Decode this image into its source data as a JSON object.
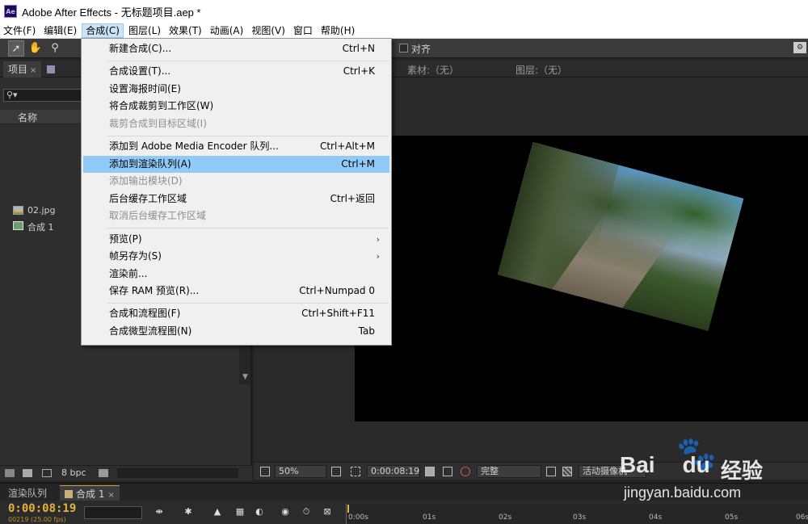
{
  "window": {
    "title": "Adobe After Effects - 无标题项目.aep *",
    "logo_text": "Ae"
  },
  "menubar": [
    {
      "label": "文件(F)"
    },
    {
      "label": "编辑(E)"
    },
    {
      "label": "合成(C)",
      "active": true
    },
    {
      "label": "图层(L)"
    },
    {
      "label": "效果(T)"
    },
    {
      "label": "动画(A)"
    },
    {
      "label": "视图(V)"
    },
    {
      "label": "窗口"
    },
    {
      "label": "帮助(H)"
    }
  ],
  "toolbar": {
    "align_label": "对齐"
  },
  "project_panel": {
    "tab_label": "项目",
    "close_glyph": "×",
    "column_name": "名称",
    "items": [
      {
        "label": "02.jpg",
        "type": "image"
      },
      {
        "label": "合成 1",
        "type": "composition"
      }
    ],
    "bit_depth": "8 bpc"
  },
  "composition_header": {
    "footage_label": "素材:（无）",
    "layer_label": "图层:（无）"
  },
  "composition_menu": {
    "groups": [
      [
        {
          "label": "新建合成(C)...",
          "shortcut": "Ctrl+N"
        }
      ],
      [
        {
          "label": "合成设置(T)...",
          "shortcut": "Ctrl+K"
        },
        {
          "label": "设置海报时间(E)",
          "shortcut": ""
        },
        {
          "label": "将合成裁剪到工作区(W)",
          "shortcut": ""
        },
        {
          "label": "裁剪合成到目标区域(I)",
          "shortcut": "",
          "disabled": true
        }
      ],
      [
        {
          "label": "添加到 Adobe Media Encoder 队列...",
          "shortcut": "Ctrl+Alt+M"
        },
        {
          "label": "添加到渲染队列(A)",
          "shortcut": "Ctrl+M",
          "highlighted": true
        },
        {
          "label": "添加输出模块(D)",
          "shortcut": "",
          "disabled": true
        },
        {
          "label": "后台缓存工作区域",
          "shortcut": "Ctrl+返回"
        },
        {
          "label": "取消后台缓存工作区域",
          "shortcut": "",
          "disabled": true
        }
      ],
      [
        {
          "label": "预览(P)",
          "shortcut": "",
          "submenu": true
        },
        {
          "label": "帧另存为(S)",
          "shortcut": "",
          "submenu": true
        },
        {
          "label": "渲染前...",
          "shortcut": ""
        },
        {
          "label": "保存 RAM 预览(R)...",
          "shortcut": "Ctrl+Numpad 0"
        }
      ],
      [
        {
          "label": "合成和流程图(F)",
          "shortcut": "Ctrl+Shift+F11"
        },
        {
          "label": "合成微型流程图(N)",
          "shortcut": "Tab"
        }
      ]
    ]
  },
  "viewer_bar": {
    "zoom": "50%",
    "timecode": "0:00:08:19",
    "quality": "完整",
    "camera": "活动摄像机"
  },
  "timeline": {
    "render_queue_tab": "渲染队列",
    "comp_tab": "合成 1",
    "close_glyph": "×",
    "timecode": "0:00:08:19",
    "frame_info": "00219 (25.00 fps)",
    "ruler_ticks": [
      "0:00s",
      "01s",
      "02s",
      "03s",
      "04s",
      "05s",
      "06s"
    ]
  },
  "watermark": {
    "brand": "Bai",
    "brand_suffix": "du",
    "product": "经验",
    "url": "jingyan.baidu.com"
  },
  "colors": {
    "timecode": "#e5b33b",
    "menu_highlight": "#91c9f7",
    "panel_bg": "#2e2e2e"
  }
}
